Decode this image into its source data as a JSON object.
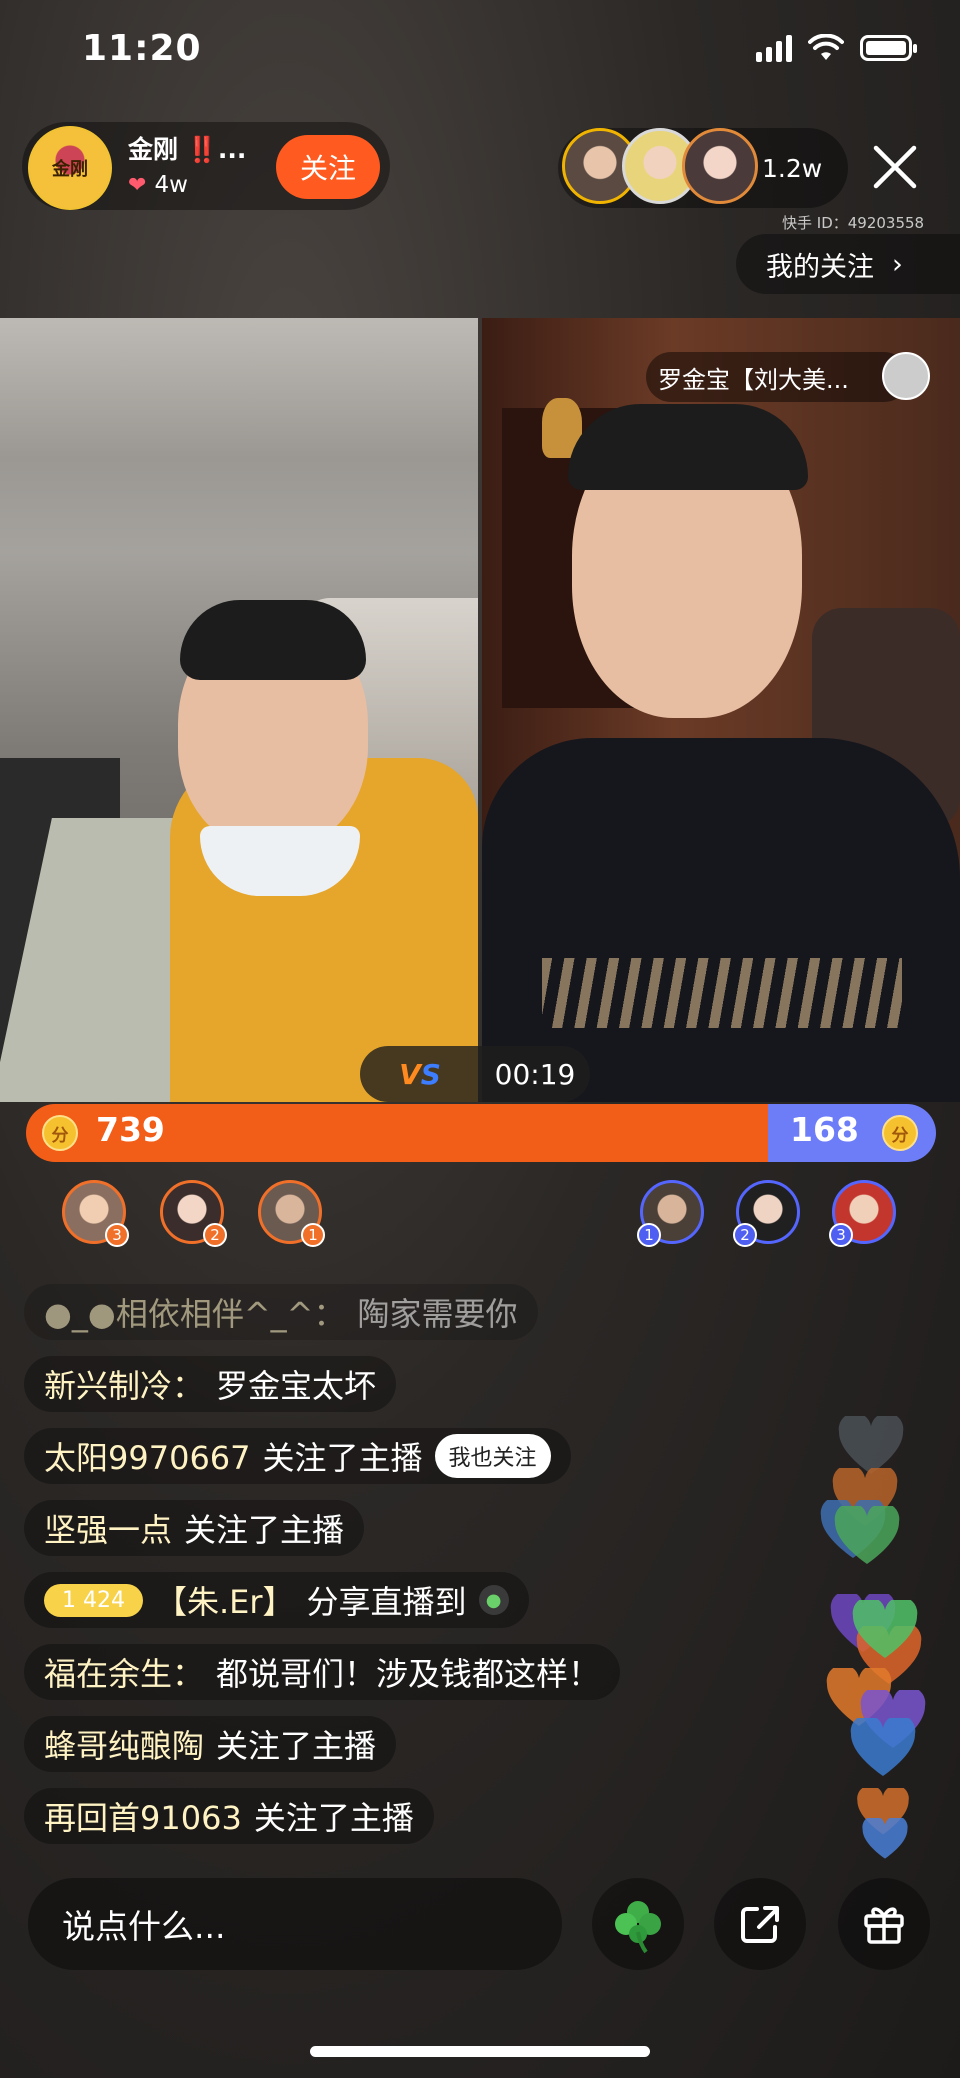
{
  "status_bar": {
    "time": "11:20"
  },
  "host": {
    "avatar_text": "金刚",
    "name": "金刚 ‼️...",
    "likes": "4w",
    "follow_label": "关注"
  },
  "viewers": {
    "count": "1.2w"
  },
  "kwai_id": "快手 ID：49203558",
  "my_follow": {
    "label": "我的关注"
  },
  "pk": {
    "opponent_name": "罗金宝【刘大美...",
    "vs_label": "VS",
    "timer": "00:19",
    "left_score": "739",
    "right_score": "168",
    "left_share": 0.815,
    "coin_label": "分",
    "left_ranks": [
      "3",
      "2",
      "1"
    ],
    "right_ranks": [
      "1",
      "2",
      "3"
    ]
  },
  "comments": [
    {
      "user": "●_●相依相伴^_^：",
      "text": "陶家需要你",
      "faded": true
    },
    {
      "user": "新兴制冷：",
      "text": "罗金宝太坏"
    },
    {
      "user": "太阳9970667",
      "text": "关注了主播",
      "action": "我也关注"
    },
    {
      "user": "坚强一点",
      "text": "关注了主播"
    },
    {
      "level": "1 424",
      "user": "【朱.Er】",
      "text": "分享直播到"
    },
    {
      "user": "福在余生：",
      "text": "都说哥们！涉及钱都这样！"
    },
    {
      "user": "蜂哥纯酿陶",
      "text": "关注了主播"
    },
    {
      "user": "再回首91063",
      "text": "关注了主播"
    }
  ],
  "bottom": {
    "input_placeholder": "说点什么..."
  },
  "colors": {
    "left_team": "#f25d18",
    "right_team": "#6d7df7",
    "follow": "#ff5a1f"
  }
}
